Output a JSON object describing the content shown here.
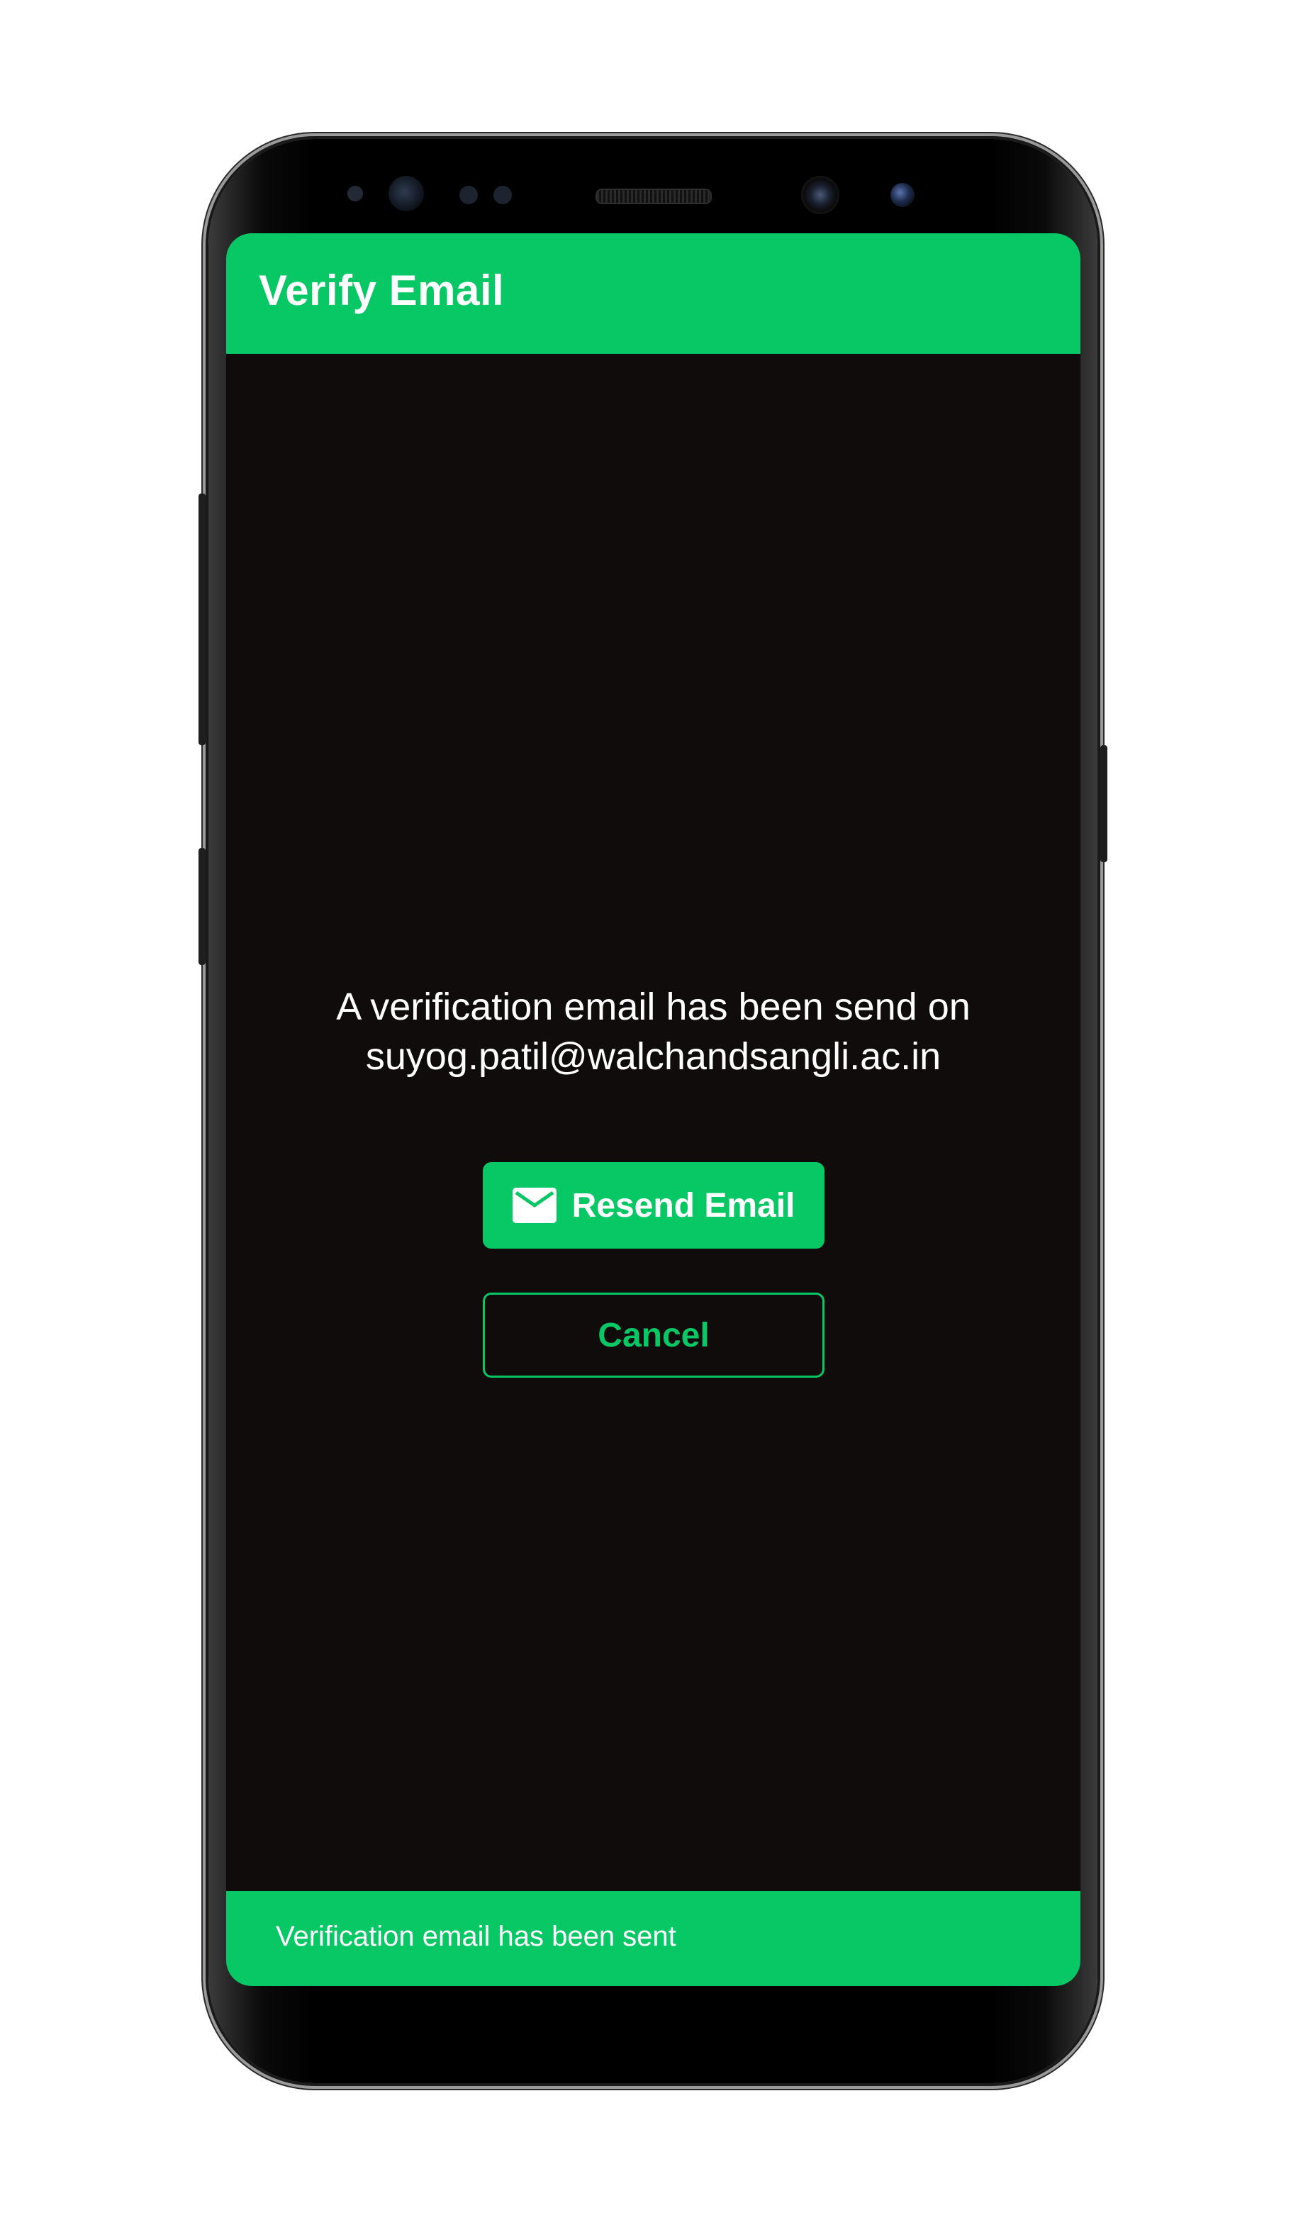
{
  "app_bar": {
    "title": "Verify Email"
  },
  "message": {
    "line1": "A verification email has been send on",
    "email": "suyog.patil@walchandsangli.ac.in"
  },
  "actions": {
    "resend_label": "Resend Email",
    "resend_icon": "mail-icon",
    "cancel_label": "Cancel"
  },
  "snackbar": {
    "text": "Verification email has been sent"
  },
  "colors": {
    "accent": "#08c765",
    "background": "#110c0c",
    "text": "#ffffff"
  }
}
